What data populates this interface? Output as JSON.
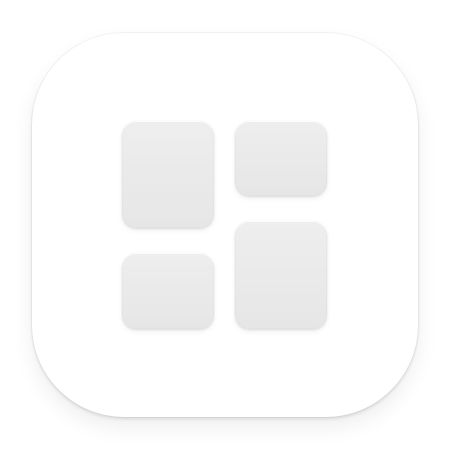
{
  "icon": {
    "name": "widgets-grid-icon",
    "background_color": "#ffffff",
    "tile_color": "#e9e9e9",
    "tiles": [
      "top-left",
      "top-right",
      "bottom-left",
      "bottom-right"
    ]
  }
}
